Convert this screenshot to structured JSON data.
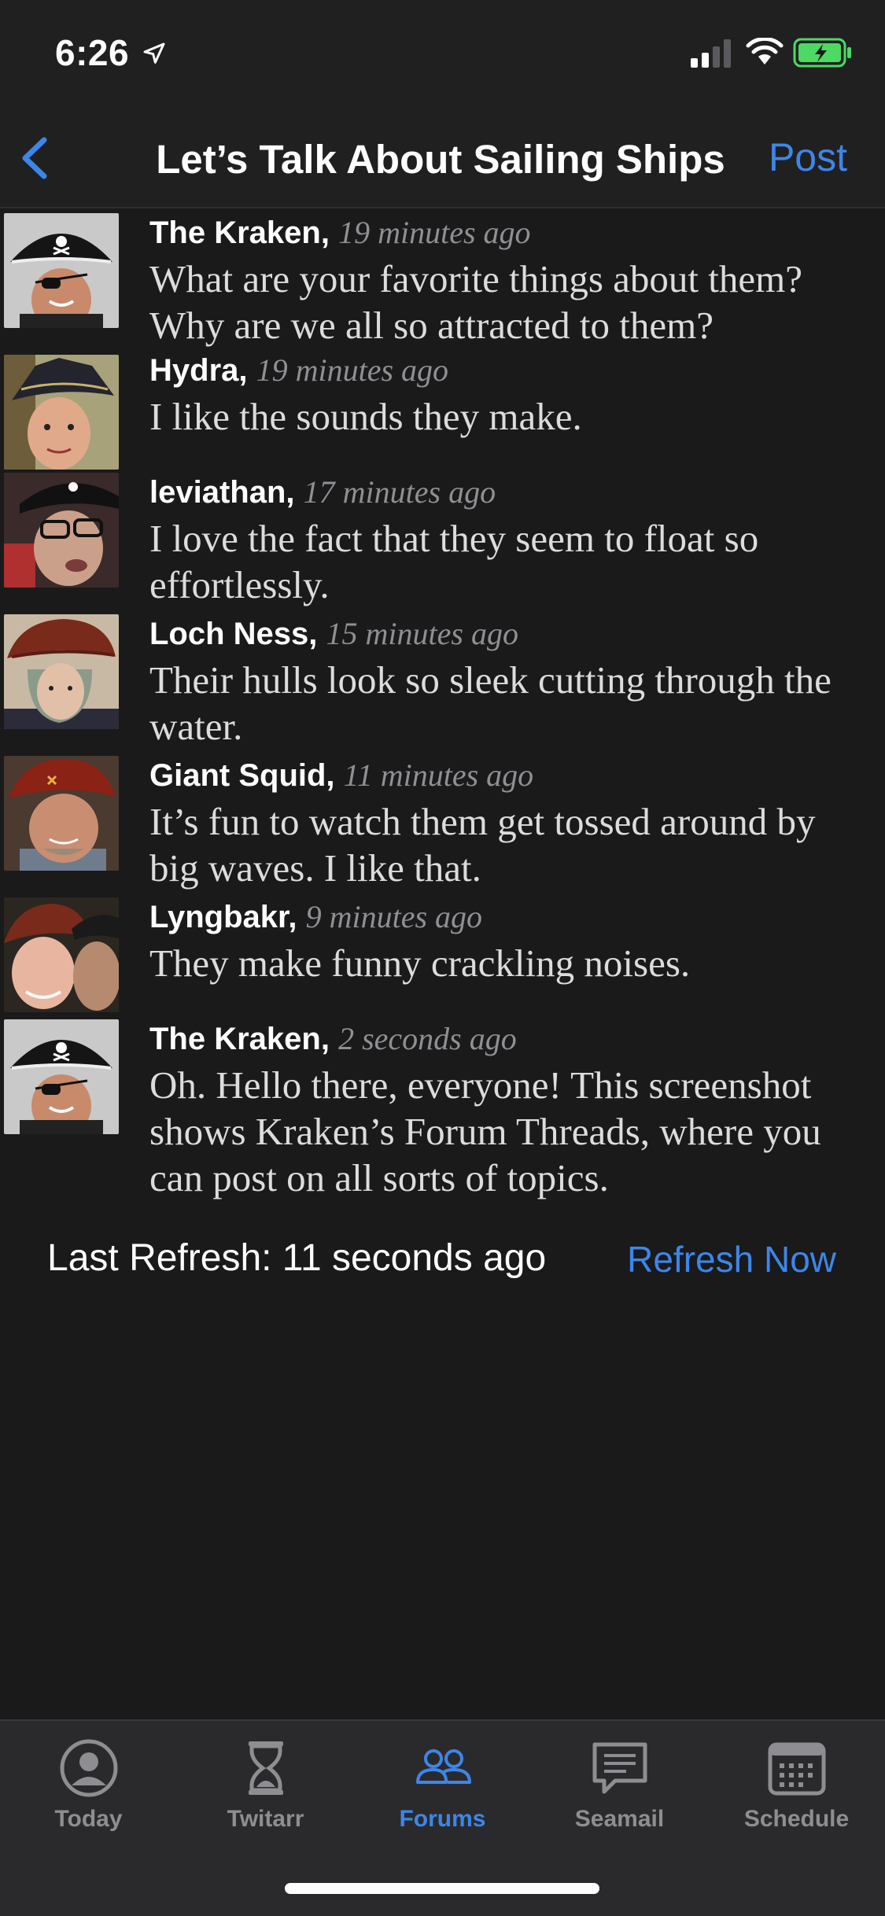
{
  "status_bar": {
    "time": "6:26"
  },
  "nav": {
    "title": "Let’s Talk About Sailing Ships",
    "post_label": "Post"
  },
  "posts": [
    {
      "author": "The Kraken,",
      "time": "19 minutes ago",
      "text": "What are your favorite things about them? Why are we all so attracted to them?",
      "avatar": "kraken"
    },
    {
      "author": "Hydra,",
      "time": "19 minutes ago",
      "text": "I like the sounds they make.",
      "avatar": "hydra"
    },
    {
      "author": "leviathan,",
      "time": "17 minutes ago",
      "text": "I love the fact that they seem to float so effortlessly.",
      "avatar": "leviathan"
    },
    {
      "author": "Loch Ness,",
      "time": "15 minutes ago",
      "text": "Their hulls look so sleek cutting through the water.",
      "avatar": "lochness"
    },
    {
      "author": "Giant Squid,",
      "time": "11 minutes ago",
      "text": "It’s fun to watch them get tossed around by big waves. I like that.",
      "avatar": "squid"
    },
    {
      "author": "Lyngbakr,",
      "time": "9 minutes ago",
      "text": "They make funny crackling noises.",
      "avatar": "lyngbakr"
    },
    {
      "author": "The Kraken,",
      "time": "2 seconds ago",
      "text": "Oh. Hello there, everyone! This screenshot shows Kraken’s Forum Threads, where you can post on all sorts of topics.",
      "avatar": "kraken"
    }
  ],
  "refresh": {
    "label": "Last Refresh: 11 seconds ago",
    "button": "Refresh Now"
  },
  "tabs": [
    {
      "label": "Today",
      "icon": "person-circle-icon",
      "active": false
    },
    {
      "label": "Twitarr",
      "icon": "hourglass-icon",
      "active": false
    },
    {
      "label": "Forums",
      "icon": "people-icon",
      "active": true
    },
    {
      "label": "Seamail",
      "icon": "chat-bubble-icon",
      "active": false
    },
    {
      "label": "Schedule",
      "icon": "calendar-icon",
      "active": false
    }
  ],
  "colors": {
    "accent": "#3d86e9",
    "background": "#1a1a1b",
    "bar": "#202021",
    "secondary_text": "#8f8f94"
  }
}
